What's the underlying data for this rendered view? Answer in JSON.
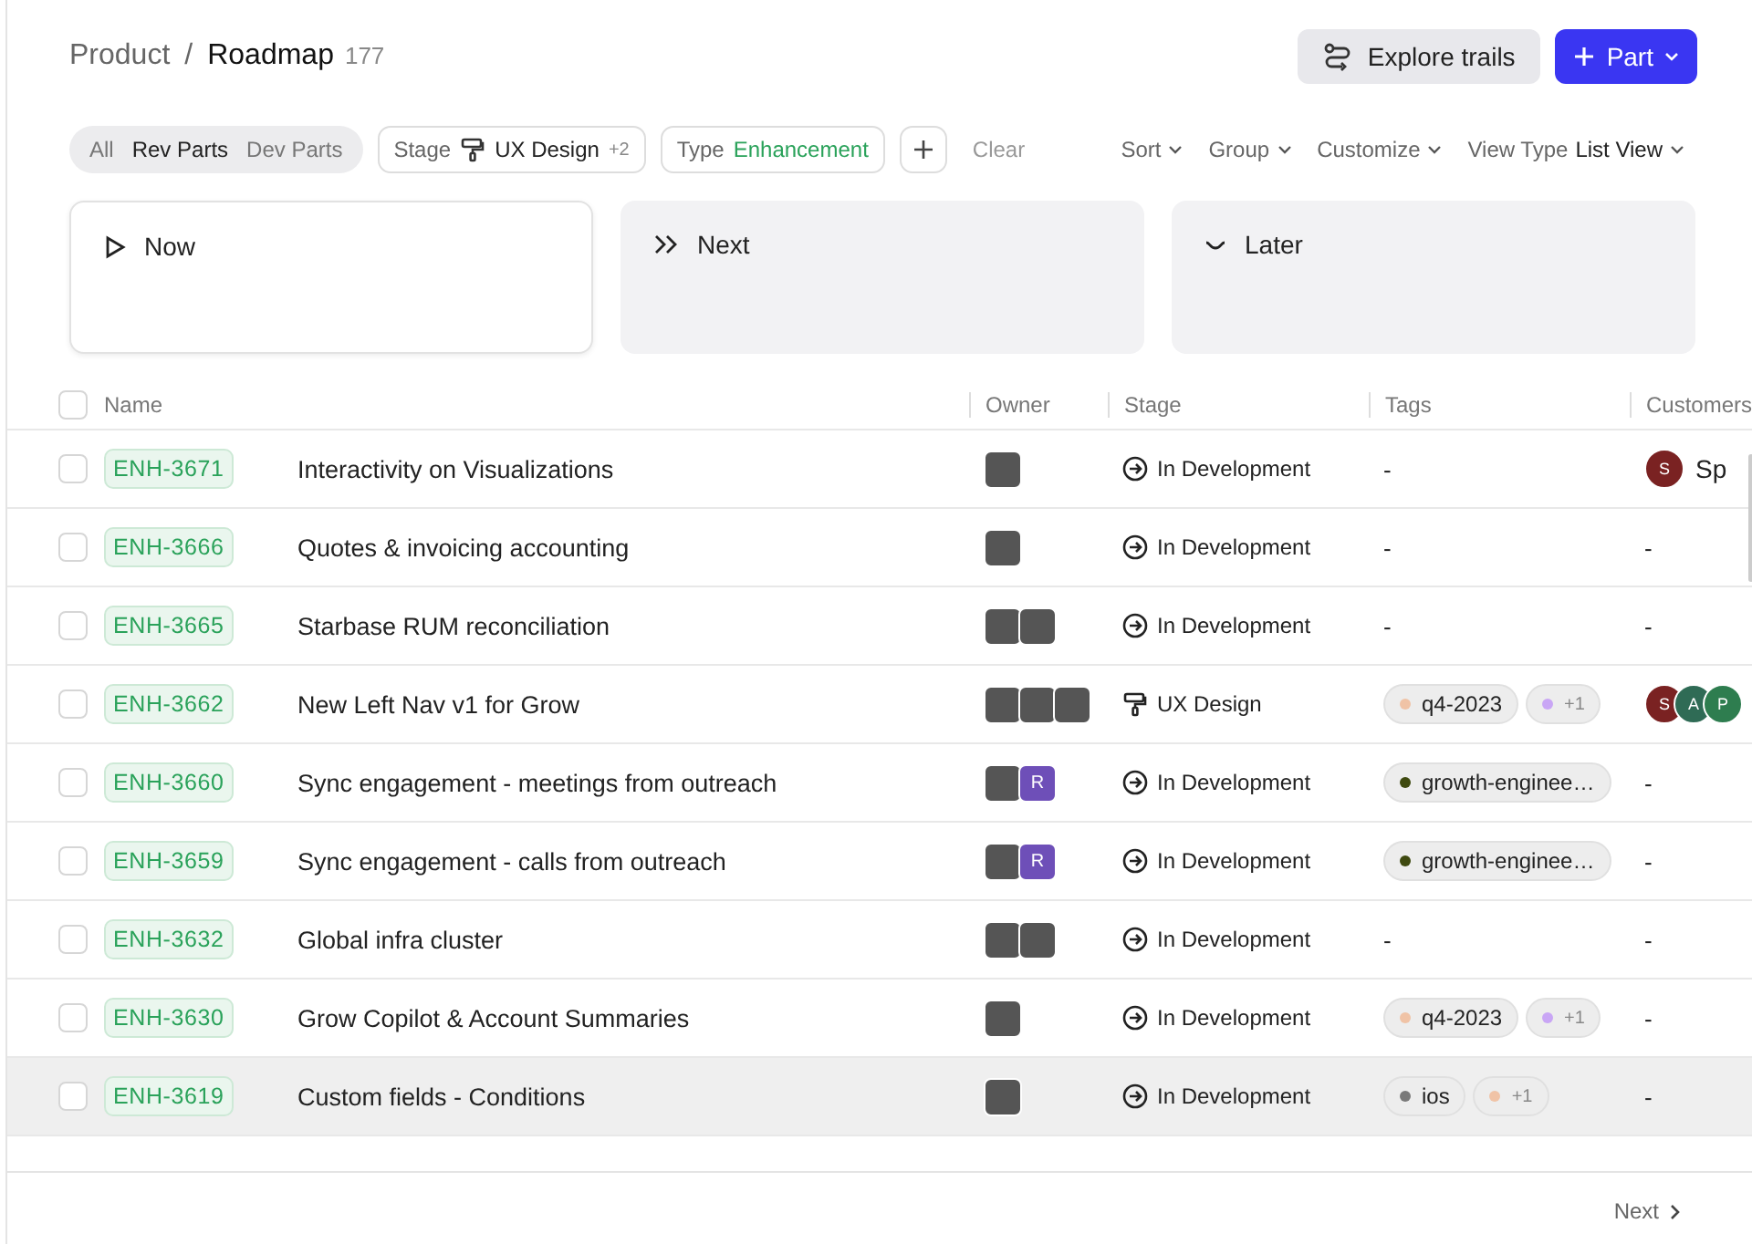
{
  "breadcrumb": {
    "parent": "Product",
    "separator": "/",
    "current": "Roadmap",
    "count": "177"
  },
  "actions": [
    {
      "kind": "secondary",
      "label": "Explore trails"
    },
    {
      "kind": "primary",
      "label": "Part"
    }
  ],
  "segments": [
    {
      "label": "All",
      "selected": false
    },
    {
      "label": "Rev Parts",
      "selected": true
    },
    {
      "label": "Dev Parts",
      "selected": false
    }
  ],
  "filters": [
    {
      "kind": "stage",
      "label": "Stage",
      "value": "UX Design",
      "extra": "+2"
    },
    {
      "kind": "type",
      "label": "Type",
      "value": "Enhancement"
    }
  ],
  "clear": "Clear",
  "view_controls": [
    {
      "label": "Sort"
    },
    {
      "label": "Group"
    },
    {
      "label": "Customize"
    },
    {
      "label": "View Type",
      "value": "List View"
    }
  ],
  "lanes": [
    {
      "kind": "now",
      "label": "Now",
      "selected": true
    },
    {
      "kind": "next",
      "label": "Next",
      "selected": false
    },
    {
      "kind": "later",
      "label": "Later",
      "selected": false
    }
  ],
  "select_all": {
    "checked": false
  },
  "table": {
    "columns": [
      "Name",
      "Owner",
      "Stage",
      "Tags",
      "Customers"
    ],
    "rows": [
      {
        "id": "ENH-3671",
        "title": "Interactivity on Visualizations",
        "selected": false,
        "owners": [
          {
            "kind": "photo"
          }
        ],
        "stage": {
          "kind": "development",
          "label": "In Development"
        },
        "tags": [],
        "tags_empty": "-",
        "customers": [
          {
            "initial": "S",
            "color": "#7a2222"
          }
        ],
        "customer_name": "Sp",
        "customers_empty": ""
      },
      {
        "id": "ENH-3666",
        "title": "Quotes & invoicing accounting",
        "selected": false,
        "owners": [
          {
            "kind": "photo"
          }
        ],
        "stage": {
          "kind": "development",
          "label": "In Development"
        },
        "tags": [],
        "tags_empty": "-",
        "customers": [],
        "customers_empty": "-"
      },
      {
        "id": "ENH-3665",
        "title": "Starbase RUM reconciliation",
        "selected": false,
        "owners": [
          {
            "kind": "photo"
          },
          {
            "kind": "photo"
          }
        ],
        "stage": {
          "kind": "development",
          "label": "In Development"
        },
        "tags": [],
        "tags_empty": "-",
        "customers": [],
        "customers_empty": "-"
      },
      {
        "id": "ENH-3662",
        "title": "New Left Nav v1 for Grow",
        "selected": false,
        "owners": [
          {
            "kind": "photo"
          },
          {
            "kind": "photo"
          },
          {
            "kind": "photo"
          }
        ],
        "stage": {
          "kind": "design",
          "label": "UX Design"
        },
        "tags": [
          {
            "kind": "tag",
            "label": "q4-2023",
            "color": "#f0c3a6"
          },
          {
            "kind": "more",
            "label": "+1",
            "color": "#c9a6f5"
          }
        ],
        "customers": [
          {
            "initial": "S",
            "color": "#7a2222"
          },
          {
            "initial": "A",
            "color": "#2f6b55"
          },
          {
            "initial": "P",
            "color": "#2e7d4f"
          }
        ],
        "customers_empty": ""
      },
      {
        "id": "ENH-3660",
        "title": "Sync engagement - meetings from outreach",
        "selected": false,
        "owners": [
          {
            "kind": "photo"
          },
          {
            "kind": "initial",
            "initial": "R",
            "color": "#6e4fb8"
          }
        ],
        "stage": {
          "kind": "development",
          "label": "In Development"
        },
        "tags": [
          {
            "kind": "tag",
            "label": "growth-enginee…",
            "color": "#3f4a10"
          }
        ],
        "customers": [],
        "customers_empty": "-"
      },
      {
        "id": "ENH-3659",
        "title": "Sync engagement - calls from outreach",
        "selected": false,
        "owners": [
          {
            "kind": "photo"
          },
          {
            "kind": "initial",
            "initial": "R",
            "color": "#6e4fb8"
          }
        ],
        "stage": {
          "kind": "development",
          "label": "In Development"
        },
        "tags": [
          {
            "kind": "tag",
            "label": "growth-enginee…",
            "color": "#3f4a10"
          }
        ],
        "customers": [],
        "customers_empty": "-"
      },
      {
        "id": "ENH-3632",
        "title": "Global infra cluster",
        "selected": false,
        "owners": [
          {
            "kind": "photo"
          },
          {
            "kind": "photo"
          }
        ],
        "stage": {
          "kind": "development",
          "label": "In Development"
        },
        "tags": [],
        "tags_empty": "-",
        "customers": [],
        "customers_empty": "-"
      },
      {
        "id": "ENH-3630",
        "title": "Grow Copilot & Account Summaries",
        "selected": false,
        "owners": [
          {
            "kind": "photo"
          }
        ],
        "stage": {
          "kind": "development",
          "label": "In Development"
        },
        "tags": [
          {
            "kind": "tag",
            "label": "q4-2023",
            "color": "#f0c3a6"
          },
          {
            "kind": "more",
            "label": "+1",
            "color": "#c9a6f5"
          }
        ],
        "customers": [],
        "customers_empty": "-"
      },
      {
        "id": "ENH-3619",
        "title": "Custom fields - Conditions",
        "selected": true,
        "owners": [
          {
            "kind": "photo"
          }
        ],
        "stage": {
          "kind": "development",
          "label": "In Development"
        },
        "tags": [
          {
            "kind": "tag",
            "label": "ios",
            "color": "#7a7a7a"
          },
          {
            "kind": "more",
            "label": "+1",
            "color": "#f0c3a6"
          }
        ],
        "customers": [],
        "customers_empty": "-"
      }
    ]
  },
  "pagination": {
    "next": "Next"
  }
}
